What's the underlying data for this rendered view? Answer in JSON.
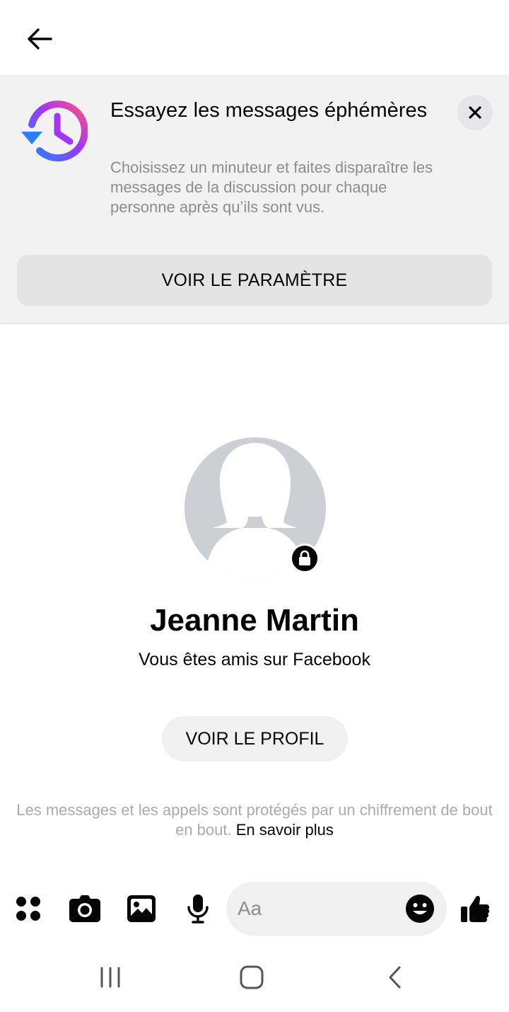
{
  "header": {
    "back_icon": "arrow-left-icon"
  },
  "banner": {
    "icon": "disappearing-messages-timer-icon",
    "title": "Essayez les messages éphémères",
    "description": "Choisissez un minuteur et faites disparaître les messages de la discussion pour chaque personne après qu’ils sont vus.",
    "close_icon": "close-icon",
    "button_label": "VOIR LE PARAMÈTRE",
    "gradient_colors": [
      "#1e88ff",
      "#a334fa",
      "#ff5280"
    ]
  },
  "profile": {
    "name": "Jeanne Martin",
    "relationship": "Vous êtes amis sur Facebook",
    "button_label": "VOIR LE PROFIL",
    "avatar_icon": "default-female-avatar-icon",
    "lock_icon": "lock-icon"
  },
  "encryption": {
    "text": "Les messages et les appels sont protégés par un chiffrement de bout en bout.",
    "link_label": "En savoir plus"
  },
  "composer": {
    "placeholder": "Aa",
    "icons": [
      "apps-icon",
      "camera-icon",
      "gallery-icon",
      "microphone-icon",
      "emoji-icon",
      "thumbs-up-icon"
    ]
  },
  "navigation": {
    "icons": [
      "recent-apps-icon",
      "home-icon",
      "back-icon"
    ]
  },
  "colors": {
    "text_primary": "#050505",
    "text_secondary": "#8a8d91",
    "surface": "#f0f0f0",
    "banner_background": "#f2f2f2"
  }
}
